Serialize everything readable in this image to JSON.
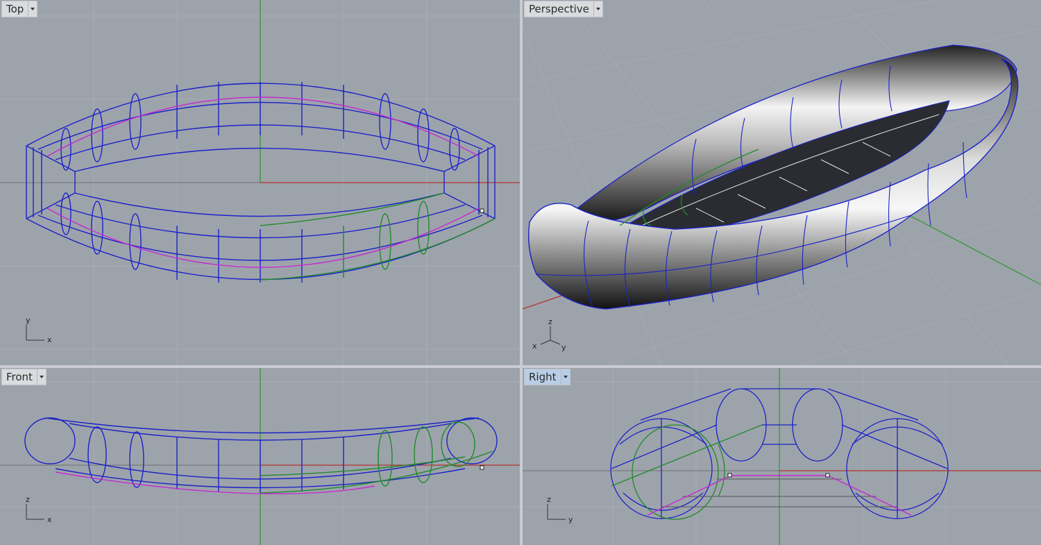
{
  "viewports": {
    "top": {
      "label": "Top",
      "axis_h": "x",
      "axis_v": "y"
    },
    "perspective": {
      "label": "Perspective",
      "axis_a": "x",
      "axis_b": "y",
      "axis_v": "z"
    },
    "front": {
      "label": "Front",
      "axis_h": "x",
      "axis_v": "z"
    },
    "right": {
      "label": "Right",
      "axis_h": "y",
      "axis_v": "z",
      "active": true
    }
  },
  "colors": {
    "viewport_bg": "#9da3ab",
    "grid": "#a9aeb5",
    "wire": "#1a22c8",
    "selected": "#1f8a2a",
    "seam": "#c52bd1",
    "x_axis": "#b1322a",
    "y_axis": "#2a9a2a"
  },
  "icons": {
    "tab_dropdown": "chevron-down-icon",
    "axis_widget": "axis-icon"
  }
}
